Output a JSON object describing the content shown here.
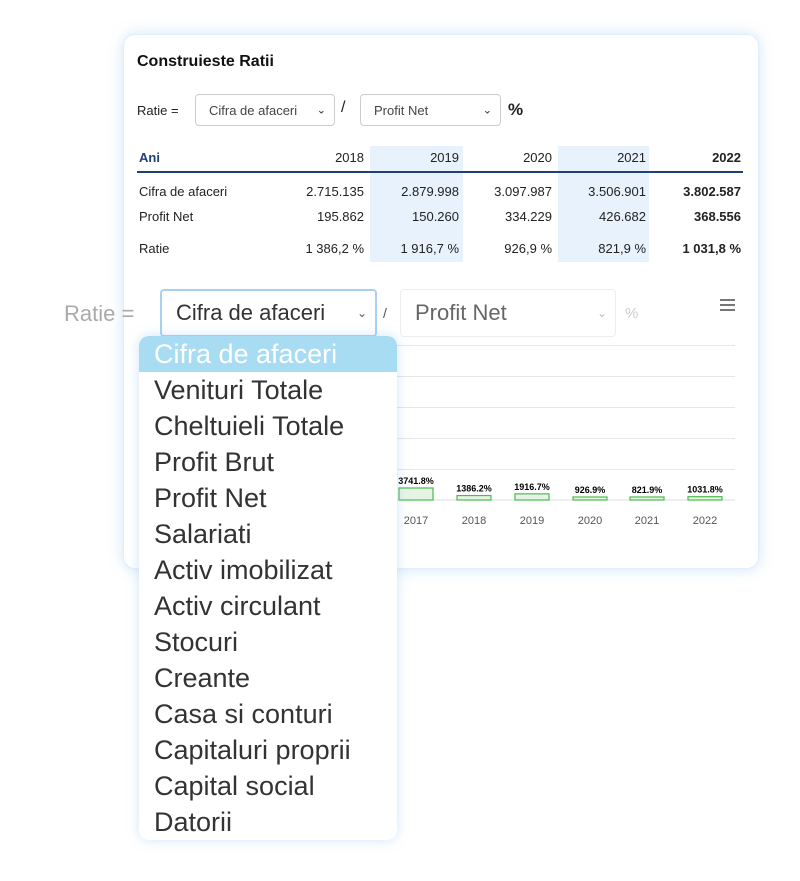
{
  "card": {
    "title": "Construieste Ratii",
    "ratio_label": "Ratie =",
    "numerator": "Cifra de afaceri",
    "slash": "/",
    "denominator": "Profit Net",
    "percent": "%"
  },
  "table": {
    "header": [
      "Ani",
      "2018",
      "2019",
      "2020",
      "2021",
      "2022"
    ],
    "rows": [
      {
        "label": "Cifra de afaceri",
        "values": [
          "2.715.135",
          "2.879.998",
          "3.097.987",
          "3.506.901",
          "3.802.587"
        ]
      },
      {
        "label": "Profit Net",
        "values": [
          "195.862",
          "150.260",
          "334.229",
          "426.682",
          "368.556"
        ]
      },
      {
        "label": "Ratie",
        "values": [
          "1 386,2 %",
          "1 916,7 %",
          "926,9 %",
          "821,9 %",
          "1 031,8 %"
        ]
      }
    ],
    "highlight_color": "#e8f2fd",
    "header_color": "#1f3f77"
  },
  "overlay": {
    "ratio_label": "Ratie =",
    "numerator": "Cifra de afaceri",
    "slash": "/",
    "denominator": "Profit Net",
    "percent": "%",
    "menu_icon": "hamburger-menu-icon"
  },
  "dropdown": {
    "options": [
      "Cifra de afaceri",
      "Venituri Totale",
      "Cheltuieli Totale",
      "Profit Brut",
      "Profit Net",
      "Salariati",
      "Activ imobilizat",
      "Activ circulant",
      "Stocuri",
      "Creante",
      "Casa si conturi",
      "Capitaluri proprii",
      "Capital social",
      "Datorii"
    ],
    "selected": "Cifra de afaceri",
    "highlight_color": "#a8dcf2"
  },
  "chart_data": {
    "type": "bar",
    "categories": [
      "2017",
      "2018",
      "2019",
      "2020",
      "2021",
      "2022"
    ],
    "values": [
      3741.8,
      1386.2,
      1916.7,
      926.9,
      821.9,
      1031.8
    ],
    "labels": [
      "3741.8%",
      "1386.2%",
      "1916.7%",
      "926.9%",
      "821.9%",
      "1031.8%"
    ],
    "grid": true,
    "bar_fill": "#e6f4e6",
    "bar_stroke": "#4cbb4c"
  }
}
